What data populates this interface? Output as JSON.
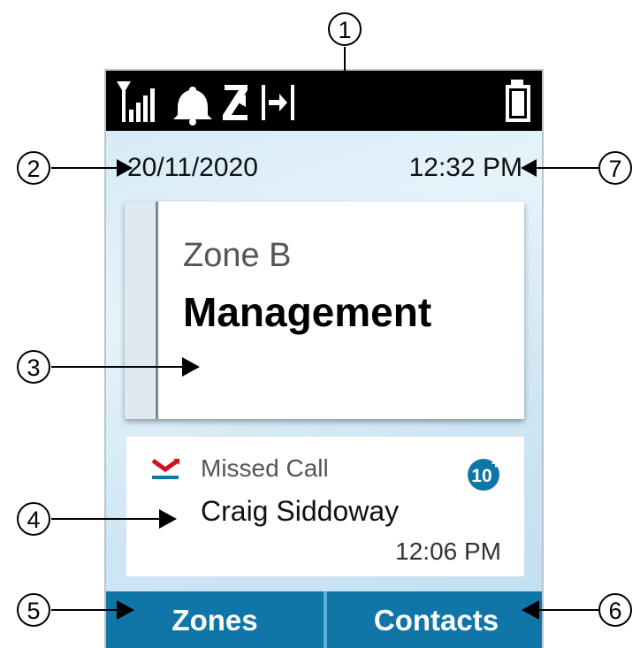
{
  "status_bar": {
    "icons": [
      "signal-strength-icon",
      "bell-icon",
      "scan-icon",
      "talkaround-icon",
      "battery-icon"
    ]
  },
  "date": "20/11/2020",
  "time": "12:32 PM",
  "channel": {
    "zone": "Zone B",
    "name": "Management"
  },
  "notification": {
    "title": "Missed Call",
    "caller": "Craig Siddoway",
    "time": "12:06 PM",
    "badge": "10"
  },
  "softkeys": {
    "left": "Zones",
    "right": "Contacts"
  },
  "callouts": [
    "1",
    "2",
    "3",
    "4",
    "5",
    "6",
    "7"
  ],
  "colors": {
    "status_bar": "#000000",
    "softkey": "#0f76a7",
    "badge": "#0f76a7",
    "missed_call_red": "#d0101a"
  }
}
